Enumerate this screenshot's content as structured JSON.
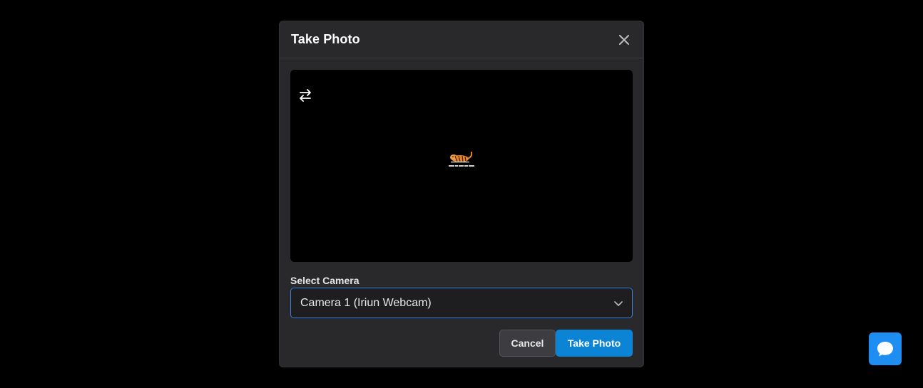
{
  "modal": {
    "title": "Take Photo",
    "close_icon": "close-icon",
    "switch_camera_icon": "switch-camera-icon",
    "camera_label": "Select Camera",
    "camera_selected": "Camera 1 (Iriun Webcam)",
    "camera_dropdown_icon": "chevron-down-icon",
    "cancel_label": "Cancel",
    "take_photo_label": "Take Photo"
  },
  "chat_widget": {
    "icon": "chat-bubble-icon",
    "color": "#1e8ef2"
  },
  "colors": {
    "accent": "#0b84d6",
    "focus_border": "#3b7ddd",
    "modal_bg": "#29292c"
  }
}
